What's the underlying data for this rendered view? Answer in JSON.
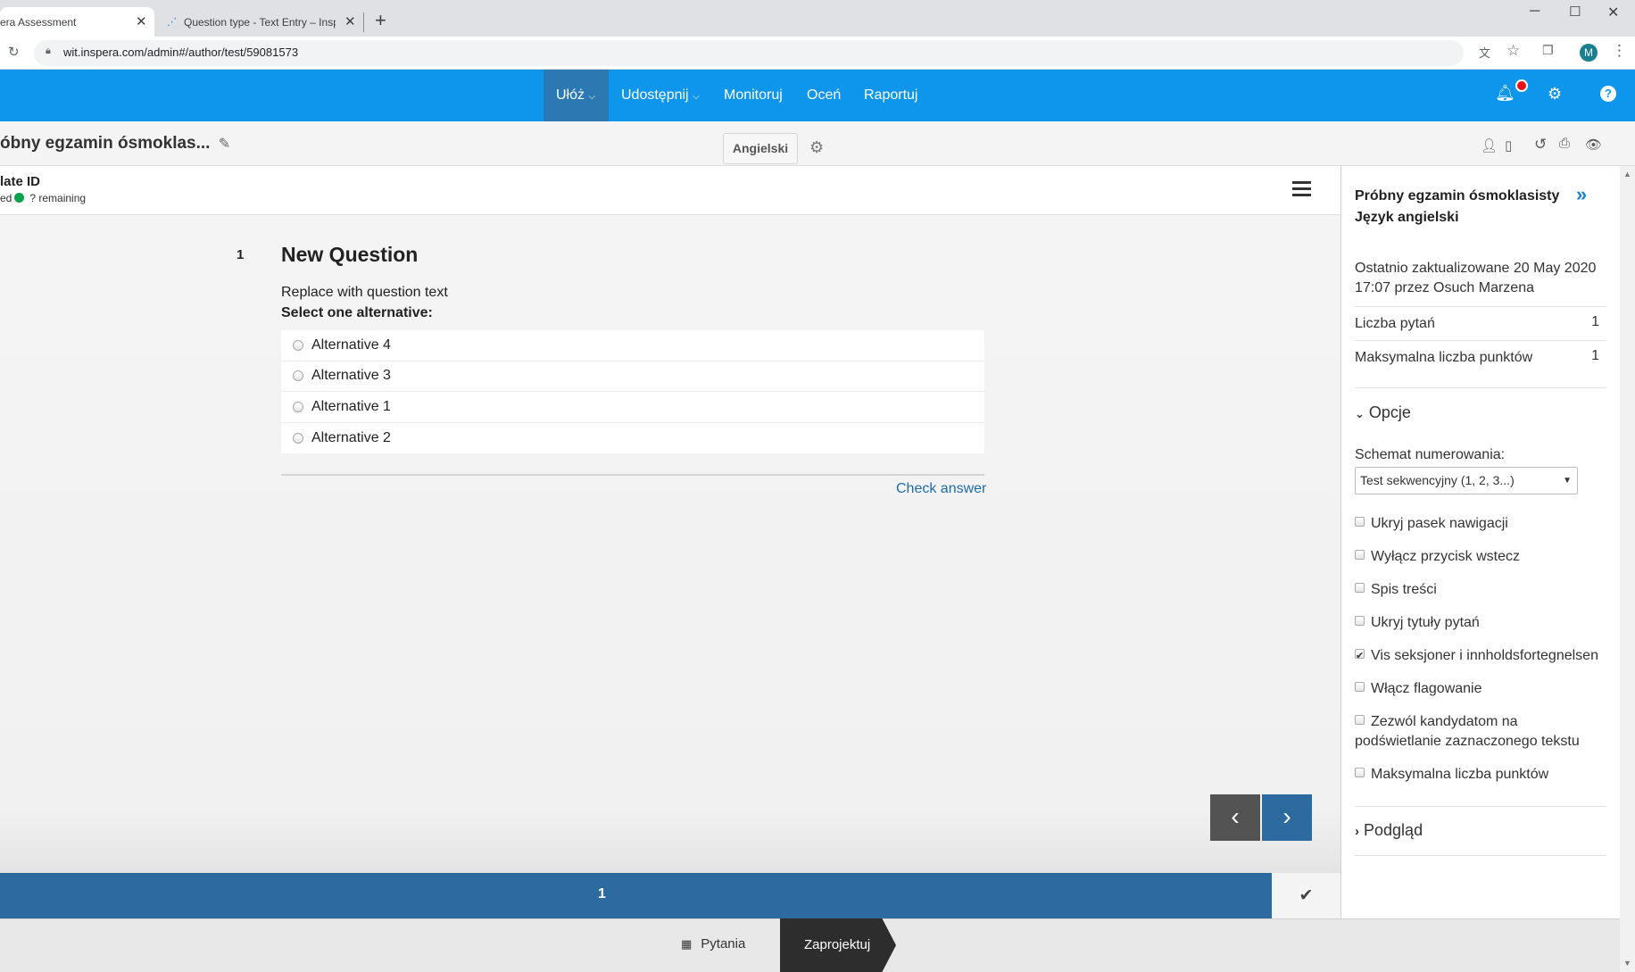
{
  "browser": {
    "tabs": [
      {
        "title": "era Assessment",
        "active": true
      },
      {
        "title": "Question type - Text Entry – Insp",
        "active": false
      }
    ],
    "url": "wit.inspera.com/admin#/author/test/59081573",
    "profile_initial": "M"
  },
  "nav": {
    "items": [
      {
        "label": "Ułóż",
        "active": true,
        "dropdown": true
      },
      {
        "label": "Udostępnij",
        "active": false,
        "dropdown": true
      },
      {
        "label": "Monitoruj",
        "active": false,
        "dropdown": false
      },
      {
        "label": "Oceń",
        "active": false,
        "dropdown": false
      },
      {
        "label": "Raportuj",
        "active": false,
        "dropdown": false
      }
    ]
  },
  "titlebar": {
    "test_title": "óbny egzamin ósmoklas...",
    "language": "Angielski"
  },
  "candidate": {
    "id_label": "late ID",
    "status_prefix": "ed",
    "remaining": "? remaining"
  },
  "question": {
    "number": "1",
    "title": "New Question",
    "text": "Replace with question text",
    "instruction": "Select one alternative:",
    "alternatives": [
      "Alternative 4",
      "Alternative 3",
      "Alternative 1",
      "Alternative 2"
    ],
    "check_answer": "Check answer"
  },
  "pagebar": {
    "current_page": "1"
  },
  "bottombar": {
    "questions_label": "Pytania",
    "design_label": "Zaprojektuj"
  },
  "sidepanel": {
    "title_line1": "Próbny egzamin ósmoklasisty",
    "title_line2": "Język angielski",
    "updated_line1": "Ostatnio zaktualizowane 20 May 2020",
    "updated_line2": "17:07 przez Osuch Marzena",
    "question_count_label": "Liczba pytań",
    "question_count_value": "1",
    "max_points_label": "Maksymalna liczba punktów",
    "max_points_value": "1",
    "options_section": "Opcje",
    "numbering_label": "Schemat numerowania:",
    "numbering_value": "Test sekwencyjny (1, 2, 3...)",
    "checkboxes": [
      {
        "label": "Ukryj pasek nawigacji",
        "checked": false
      },
      {
        "label": "Wyłącz przycisk wstecz",
        "checked": false
      },
      {
        "label": "Spis treści",
        "checked": false
      },
      {
        "label": "Ukryj tytuły pytań",
        "checked": false
      },
      {
        "label": "Vis seksjoner i innholdsfortegnelsen",
        "checked": true
      },
      {
        "label": "Włącz flagowanie",
        "checked": false
      },
      {
        "label": "Zezwól kandydatom na",
        "label_line2": "podświetlanie zaznaczonego tekstu",
        "checked": false
      },
      {
        "label": "Maksymalna liczba punktów",
        "checked": false
      }
    ],
    "preview_section": "Podgląd"
  },
  "colors": {
    "nav_bg": "#0e96ec",
    "nav_active": "#2b78b3",
    "pagebar_bg": "#2c6aa0",
    "notification": "#e8101b",
    "status_green": "#0aa34b"
  }
}
